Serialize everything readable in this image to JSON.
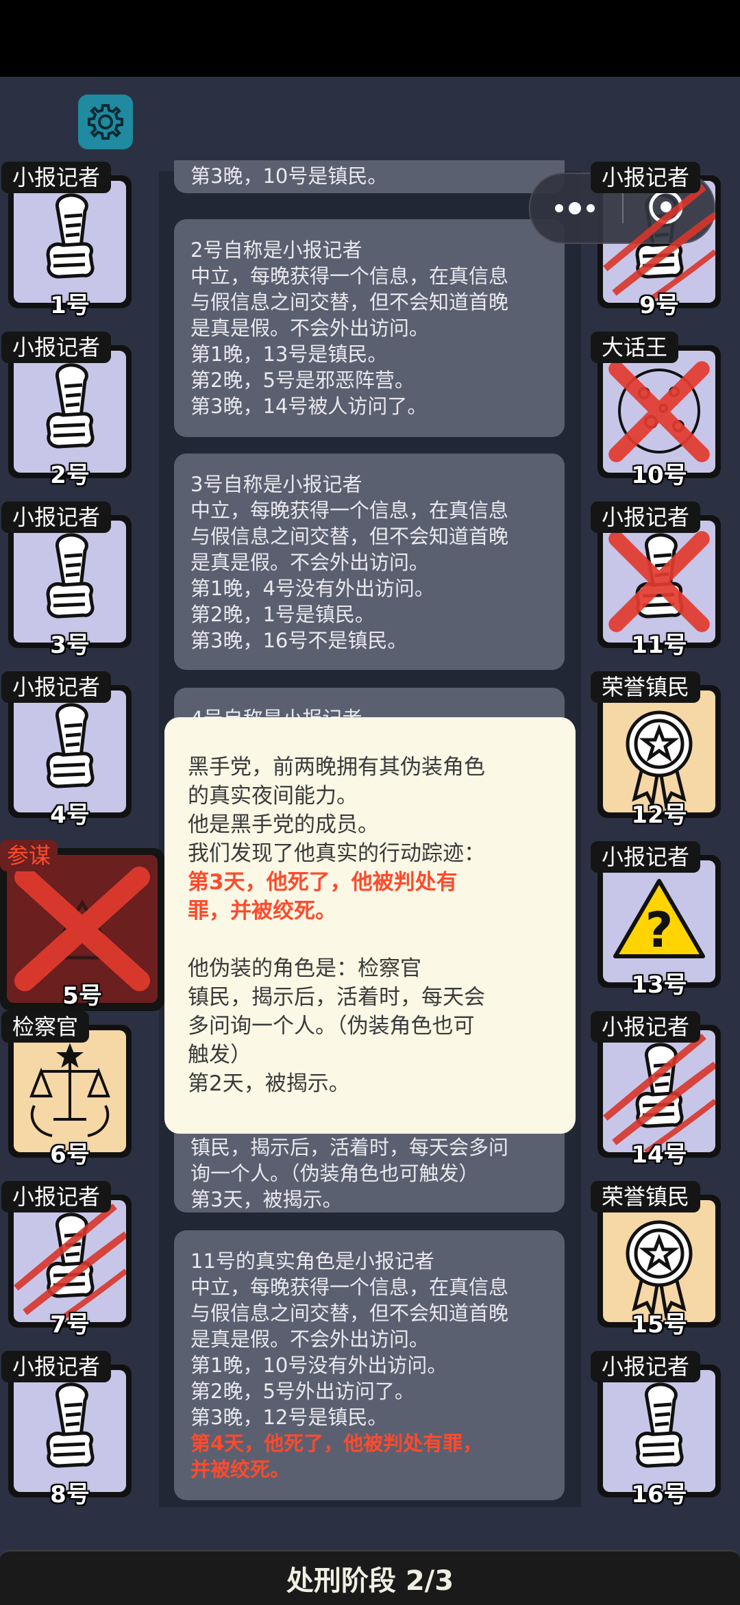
{
  "settings_icon": "gear-icon",
  "mini_program": {
    "more_icon": "more-dots-icon",
    "close_icon": "target-close-icon"
  },
  "players_left": [
    {
      "role": "小报记者",
      "number": "1号",
      "icon": "newspaper-hand-icon",
      "mark": "none"
    },
    {
      "role": "小报记者",
      "number": "2号",
      "icon": "newspaper-hand-icon",
      "mark": "none"
    },
    {
      "role": "小报记者",
      "number": "3号",
      "icon": "newspaper-hand-icon",
      "mark": "none"
    },
    {
      "role": "小报记者",
      "number": "4号",
      "icon": "newspaper-hand-icon",
      "mark": "none"
    },
    {
      "role": "参谋",
      "number": "5号",
      "icon": "strategist-icon",
      "mark": "red-x"
    },
    {
      "role": "检察官",
      "number": "6号",
      "icon": "justice-scales-icon",
      "mark": "none"
    },
    {
      "role": "小报记者",
      "number": "7号",
      "icon": "newspaper-hand-icon",
      "mark": "claw"
    },
    {
      "role": "小报记者",
      "number": "8号",
      "icon": "newspaper-hand-icon",
      "mark": "none"
    }
  ],
  "players_right": [
    {
      "role": "小报记者",
      "number": "9号",
      "icon": "newspaper-hand-icon",
      "mark": "claw"
    },
    {
      "role": "大话王",
      "number": "10号",
      "icon": "cookie-icon",
      "mark": "red-x"
    },
    {
      "role": "小报记者",
      "number": "11号",
      "icon": "newspaper-hand-icon",
      "mark": "red-x"
    },
    {
      "role": "荣誉镇民",
      "number": "12号",
      "icon": "honor-medal-icon",
      "mark": "none"
    },
    {
      "role": "小报记者",
      "number": "13号",
      "icon": "warning-question-icon",
      "mark": "none"
    },
    {
      "role": "小报记者",
      "number": "14号",
      "icon": "newspaper-hand-icon",
      "mark": "claw"
    },
    {
      "role": "荣誉镇民",
      "number": "15号",
      "icon": "honor-medal-icon",
      "mark": "none"
    },
    {
      "role": "小报记者",
      "number": "16号",
      "icon": "newspaper-hand-icon",
      "mark": "none"
    }
  ],
  "logs": [
    {
      "lines": [
        "第3晚，10号是镇民。"
      ],
      "red": []
    },
    {
      "lines": [
        "2号自称是小报记者",
        "中立，每晚获得一个信息，在真信息",
        "与假信息之间交替，但不会知道首晚",
        "是真是假。不会外出访问。",
        "第1晚，13号是镇民。",
        "第2晚，5号是邪恶阵营。",
        "第3晚，14号被人访问了。"
      ],
      "red": []
    },
    {
      "lines": [
        "3号自称是小报记者",
        "中立，每晚获得一个信息，在真信息",
        "与假信息之间交替，但不会知道首晚",
        "是真是假。不会外出访问。",
        "第1晚，4号没有外出访问。",
        "第2晚，1号是镇民。",
        "第3晚，16号不是镇民。"
      ],
      "red": []
    },
    {
      "lines": [
        "4号自称是小报记者"
      ],
      "red": []
    },
    {
      "lines": [
        "镇民，揭示后，活着时，每天会多问",
        "询一个人。（伪装角色也可触发）",
        "第3天，被揭示。"
      ],
      "red": []
    },
    {
      "lines": [
        "11号的真实角色是小报记者",
        "中立，每晚获得一个信息，在真信息",
        "与假信息之间交替，但不会知道首晚",
        "是真是假。不会外出访问。",
        "第1晚，10号没有外出访问。",
        "第2晚，5号外出访问了。",
        "第3晚，12号是镇民。"
      ],
      "red": [
        "第4天，他死了，他被判处有罪，",
        "并被绞死。"
      ]
    }
  ],
  "popup": {
    "intro": [
      "黑手党，前两晚拥有其伪装角色",
      "的真实夜间能力。",
      "他是黑手党的成员。",
      "我们发现了他真实的行动踪迹："
    ],
    "red": [
      "第3天，他死了，他被判处有",
      "罪，并被绞死。"
    ],
    "disguise": [
      "他伪装的角色是：检察官",
      "镇民，揭示后，活着时，每天会",
      "多问询一个人。（伪装角色也可",
      "触发）",
      "第2天，被揭示。"
    ]
  },
  "phase_label": "处刑阶段 2/3",
  "colors": {
    "accent_red": "#ff4a2c",
    "card_lavender": "#c8c6e8",
    "card_peach": "#f6d7a6",
    "popup_bg": "#fbf8e6"
  }
}
